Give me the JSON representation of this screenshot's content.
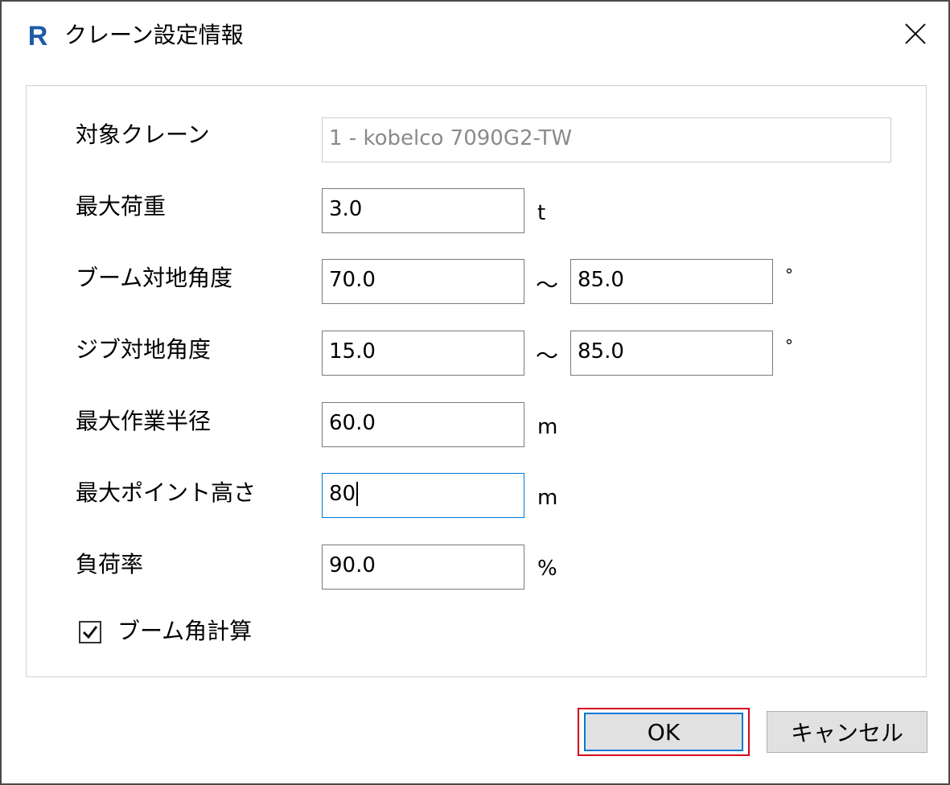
{
  "window": {
    "title": "クレーン設定情報",
    "app_icon_letter": "R"
  },
  "form": {
    "target_crane": {
      "label": "対象クレーン",
      "value": "1 - kobelco 7090G2-TW"
    },
    "max_load": {
      "label": "最大荷重",
      "value": "3.0",
      "unit": "t"
    },
    "boom_angle": {
      "label": "ブーム対地角度",
      "min": "70.0",
      "separator": "～",
      "max": "85.0",
      "unit": "°"
    },
    "jib_angle": {
      "label": "ジブ対地角度",
      "min": "15.0",
      "separator": "～",
      "max": "85.0",
      "unit": "°"
    },
    "max_working_radius": {
      "label": "最大作業半径",
      "value": "60.0",
      "unit": "m"
    },
    "max_point_height": {
      "label": "最大ポイント高さ",
      "value": "80",
      "unit": "m"
    },
    "load_rate": {
      "label": "負荷率",
      "value": "90.0",
      "unit": "%"
    },
    "boom_angle_calc": {
      "label": "ブーム角計算",
      "checked": true
    }
  },
  "buttons": {
    "ok": "OK",
    "cancel": "キャンセル"
  },
  "colors": {
    "app_icon": "#1f5ba7",
    "focus": "#0078d7",
    "ok_highlight": "#d4001c"
  }
}
